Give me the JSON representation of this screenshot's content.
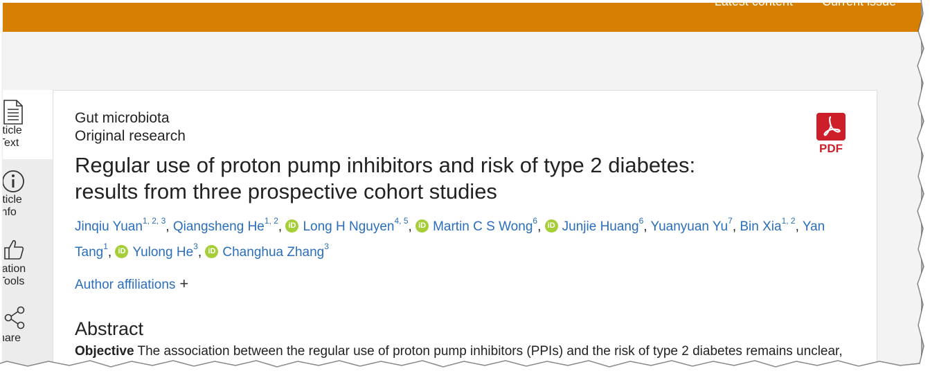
{
  "top_nav": {
    "latest": "Latest content",
    "current": "Current issue"
  },
  "sidebar": {
    "items": [
      {
        "label_line1": "rticle",
        "label_line2": "Text",
        "icon": "document-icon"
      },
      {
        "label_line1": "rticle",
        "label_line2": "info",
        "icon": "info-icon"
      },
      {
        "label_line1": "tation",
        "label_line2": "Tools",
        "icon": "thumbs-up-icon"
      },
      {
        "label_line1": "hare",
        "label_line2": "",
        "icon": "share-icon"
      }
    ]
  },
  "article": {
    "section": "Gut microbiota",
    "type": "Original research",
    "title_line1": "Regular use of proton pump inhibitors and risk of type 2 diabetes:",
    "title_line2": "results from three prospective cohort studies",
    "pdf_label": "PDF",
    "authors": [
      {
        "name": "Jinqiu Yuan",
        "sup": "1, 2, 3",
        "orcid": false
      },
      {
        "name": "Qiangsheng He",
        "sup": "1, 2",
        "orcid": false
      },
      {
        "name": "Long H Nguyen",
        "sup": "4, 5",
        "orcid": true
      },
      {
        "name": "Martin C S Wong",
        "sup": "6",
        "orcid": true
      },
      {
        "name": "Junjie Huang",
        "sup": "6",
        "orcid": true
      },
      {
        "name": "Yuanyuan Yu",
        "sup": "7",
        "orcid": false
      },
      {
        "name": "Bin Xia",
        "sup": "1, 2",
        "orcid": false
      },
      {
        "name": "Yan Tang",
        "sup": "1",
        "orcid": false
      },
      {
        "name": "Yulong He",
        "sup": "3",
        "orcid": true
      },
      {
        "name": "Changhua Zhang",
        "sup": "3",
        "orcid": true
      }
    ],
    "orcid_text": "iD",
    "affiliations_label": "Author affiliations",
    "affiliations_toggle": "+",
    "abstract_heading": "Abstract",
    "abstract_objective_label": "Objective",
    "abstract_objective_text": "The association between the regular use of proton pump inhibitors (PPIs) and the risk of type 2 diabetes remains unclear,"
  },
  "colors": {
    "brand_orange": "#d77f00",
    "link_blue": "#2a6ebb",
    "pdf_red": "#cc1f2a",
    "orcid_green": "#a6ce39"
  }
}
